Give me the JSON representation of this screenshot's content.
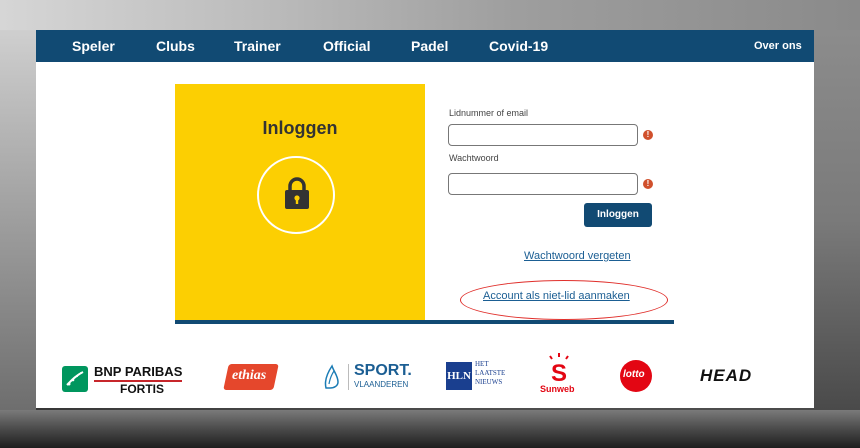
{
  "nav": {
    "items": [
      "Speler",
      "Clubs",
      "Trainer",
      "Official",
      "Padel",
      "Covid-19"
    ],
    "right_link": "Over ons",
    "bg_color": "#114a73"
  },
  "login": {
    "title": "Inloggen",
    "icon": "lock-icon",
    "panel_color": "#fccf02",
    "username_label": "Lidnummer of email",
    "username_value": "",
    "password_label": "Wachtwoord",
    "password_value": "",
    "submit_label": "Inloggen",
    "forgot_link": "Wachtwoord vergeten",
    "create_account_link": "Account als niet-lid aanmaken"
  },
  "sponsors": {
    "bnp_line1": "BNP PARIBAS",
    "bnp_line2": "FORTIS",
    "ethias": "ethias",
    "sport_line1": "SPORT.",
    "sport_line2": "VLAANDEREN",
    "hln_logo": "HLN",
    "hln_line1": "HET",
    "hln_line2": "LAATSTE",
    "hln_line3": "NIEUWS",
    "sunweb": "Sunweb",
    "lotto": "lotto",
    "head": "HEAD"
  }
}
